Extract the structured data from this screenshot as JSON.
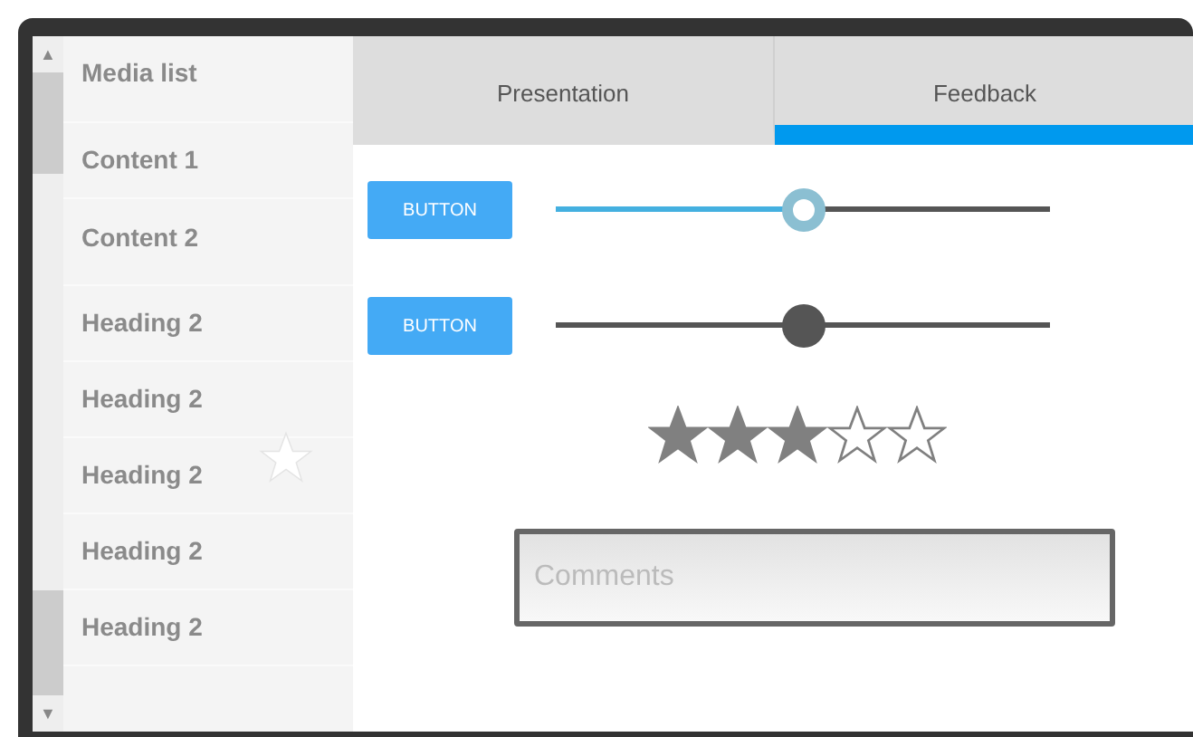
{
  "sidebar": {
    "title": "Media list",
    "items": [
      {
        "label": "Content 1"
      },
      {
        "label": "Content 2"
      },
      {
        "label": "Heading 2"
      },
      {
        "label": "Heading 2"
      },
      {
        "label": "Heading 2"
      },
      {
        "label": "Heading 2"
      },
      {
        "label": "Heading 2"
      }
    ]
  },
  "tabs": [
    {
      "label": "Presentation",
      "selected": false
    },
    {
      "label": "Feedback",
      "selected": true
    }
  ],
  "controls": [
    {
      "button": "BUTTON",
      "level": 0.5,
      "active": true
    },
    {
      "button": "BUTTON",
      "level": 0.5,
      "active": false
    }
  ],
  "scroll": {
    "up": "▲",
    "down": "▼"
  },
  "rating": {
    "stars": 3
  },
  "comments": {
    "placeholder": "Comments"
  }
}
